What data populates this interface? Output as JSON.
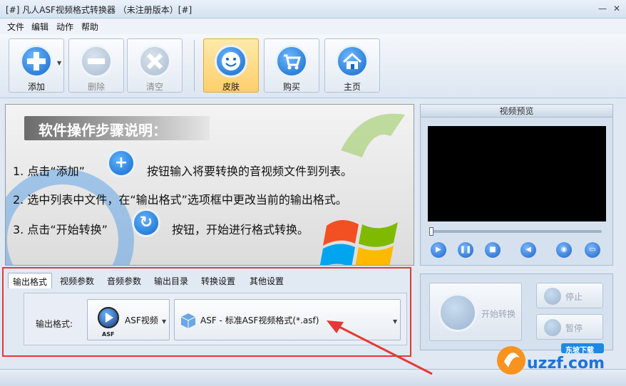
{
  "window": {
    "title": "[#] 凡人ASF视频格式转换器 （未注册版本）[#]",
    "minimize_glyph": "—",
    "close_glyph": "✕"
  },
  "menu": [
    "文件",
    "编辑",
    "动作",
    "帮助"
  ],
  "toolbar": {
    "add": {
      "label": "添加",
      "icon": "plus-icon"
    },
    "delete": {
      "label": "删除",
      "icon": "minus-icon"
    },
    "clear": {
      "label": "清空",
      "icon": "x-icon"
    },
    "skin": {
      "label": "皮肤",
      "icon": "smiley-icon"
    },
    "buy": {
      "label": "购买",
      "icon": "cart-icon"
    },
    "home": {
      "label": "主页",
      "icon": "home-icon"
    }
  },
  "guide": {
    "title": "软件操作步骤说明：",
    "step1_a": "1. 点击“添加”",
    "step1_b": "按钮输入将要转换的音视频文件到列表。",
    "step2": "2. 选中列表中文件，在“输出格式”选项框中更改当前的输出格式。",
    "step3_a": "3. 点击“开始转换”",
    "step3_b": "按钮，开始进行格式转换。"
  },
  "preview": {
    "title": "视频预览"
  },
  "settings": {
    "tabs": [
      "输出格式",
      "视频参数",
      "音频参数",
      "输出目录",
      "转换设置",
      "其他设置"
    ],
    "selected_tab": "输出格式",
    "format_label": "输出格式:",
    "format_type": "ASF视频",
    "format_icon_caption": "ASF",
    "format_value": "ASF - 标准ASF视频格式(*.asf)"
  },
  "actions": {
    "start": "开始转换",
    "stop": "停止",
    "pause": "暂停"
  },
  "watermark": {
    "site": "uzzf.com",
    "badge": "东坡下载"
  },
  "colors": {
    "accent_blue": "#1a62c5",
    "highlight_red": "#e53935",
    "active_button": "#ffcf6c"
  }
}
